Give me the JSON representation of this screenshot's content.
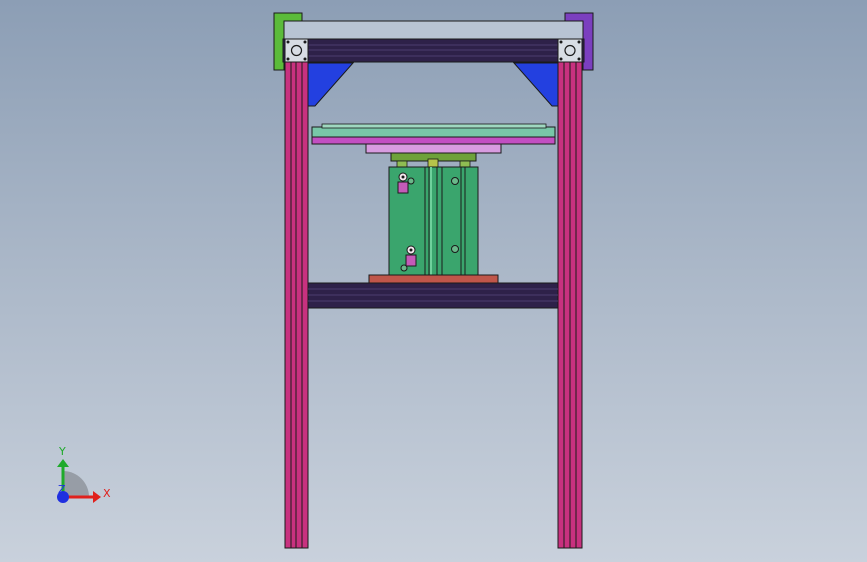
{
  "triad": {
    "x_label": "X",
    "y_label": "Y",
    "z_label": "Z",
    "x_color": "#e0201c",
    "y_color": "#1faa2b",
    "z_color": "#1f2fe0"
  },
  "model": {
    "post_color": "#c8317f",
    "top_beam_color": "#2e2149",
    "bracket_color": "#2340e0",
    "plate_color": "#78c7a8",
    "cylinder_color": "#3aa56d",
    "base_plate_color": "#c0564a",
    "corner_left_color": "#5bbb3a",
    "corner_right_color": "#7b3fbf"
  }
}
